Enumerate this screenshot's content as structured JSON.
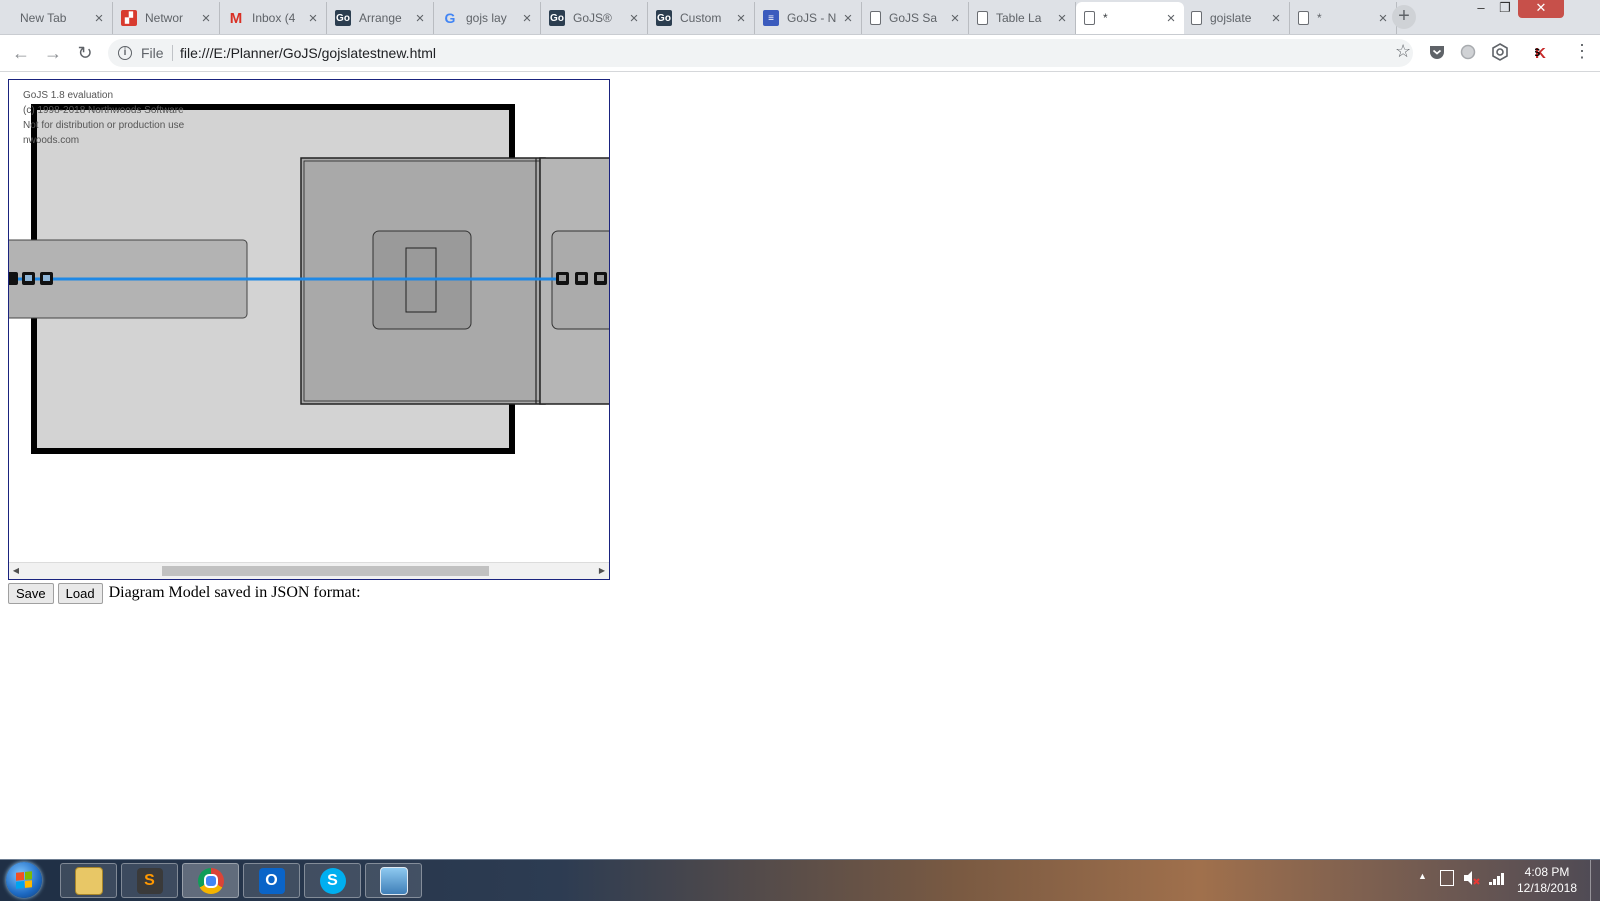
{
  "browser": {
    "tabs": [
      {
        "title": "New Tab",
        "icon": "none",
        "active": false
      },
      {
        "title": "Networ",
        "icon": "red-square-icon",
        "active": false
      },
      {
        "title": "Inbox (4",
        "icon": "gmail-icon",
        "active": false
      },
      {
        "title": "Arrange",
        "icon": "gojs-icon",
        "active": false
      },
      {
        "title": "gojs lay",
        "icon": "google-icon",
        "active": false
      },
      {
        "title": "GoJS®",
        "icon": "gojs-icon",
        "active": false
      },
      {
        "title": "Custom",
        "icon": "gojs-icon",
        "active": false
      },
      {
        "title": "GoJS - N",
        "icon": "blue-site-icon",
        "active": false
      },
      {
        "title": "GoJS Sa",
        "icon": "document-icon",
        "active": false
      },
      {
        "title": "Table La",
        "icon": "document-icon",
        "active": false
      },
      {
        "title": "*",
        "icon": "document-icon",
        "active": true
      },
      {
        "title": "gojslate",
        "icon": "document-icon",
        "active": false
      },
      {
        "title": "*",
        "icon": "document-icon",
        "active": false
      }
    ],
    "new_tab_label": "+",
    "window_controls": {
      "minimize": "–",
      "maximize": "❐",
      "close": "✕"
    },
    "nav": {
      "back": "←",
      "forward": "→",
      "reload": "↻"
    },
    "address": {
      "scheme_label": "File",
      "url": "file:///E:/Planner/GoJS/gojslatestnew.html",
      "info": "i"
    },
    "bookmark_star": "☆",
    "menu": "⋮"
  },
  "diagram": {
    "watermark": [
      "GoJS 1.8 evaluation",
      "(c) 1998-2018 Northwoods Software",
      "Not for distribution or production use",
      "nwoods.com"
    ],
    "colors": {
      "outer_fill": "#d3d3d3",
      "group_fill": "#a9a9a9",
      "node_fill": "#b3b3b3",
      "link": "#1e88e5",
      "border": "#000000"
    },
    "scroll": {
      "left_arrow": "◀",
      "right_arrow": "▶"
    }
  },
  "controls": {
    "save_label": "Save",
    "load_label": "Load",
    "json_label": "Diagram Model saved in JSON format:"
  },
  "taskbar": {
    "apps": [
      {
        "name": "file-explorer",
        "label": ""
      },
      {
        "name": "sublime-text",
        "label": "S"
      },
      {
        "name": "chrome",
        "label": ""
      },
      {
        "name": "outlook",
        "label": "O"
      },
      {
        "name": "skype",
        "label": "S"
      },
      {
        "name": "photo-viewer",
        "label": ""
      }
    ],
    "tray_arrow": "▲",
    "time": "4:08 PM",
    "date": "12/18/2018"
  }
}
